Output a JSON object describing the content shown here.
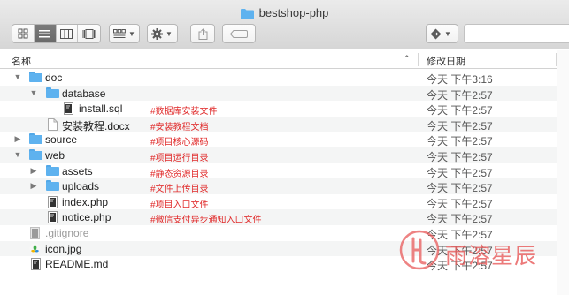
{
  "window": {
    "title": "bestshop-php"
  },
  "columns": {
    "name": "名称",
    "date": "修改日期"
  },
  "files": [
    {
      "name": "doc",
      "date": "今天 下午3:16",
      "note": ""
    },
    {
      "name": "database",
      "date": "今天 下午2:57",
      "note": ""
    },
    {
      "name": "install.sql",
      "date": "今天 下午2:57",
      "note": "#数据库安装文件"
    },
    {
      "name": "安装教程.docx",
      "date": "今天 下午2:57",
      "note": "#安装教程文档"
    },
    {
      "name": "source",
      "date": "今天 下午2:57",
      "note": "#项目核心源码"
    },
    {
      "name": "web",
      "date": "今天 下午2:57",
      "note": "#项目运行目录"
    },
    {
      "name": "assets",
      "date": "今天 下午2:57",
      "note": "#静态资源目录"
    },
    {
      "name": "uploads",
      "date": "今天 下午2:57",
      "note": "#文件上传目录"
    },
    {
      "name": "index.php",
      "date": "今天 下午2:57",
      "note": "#项目入口文件"
    },
    {
      "name": "notice.php",
      "date": "今天 下午2:57",
      "note": "#微信支付异步通知入口文件"
    },
    {
      "name": ".gitignore",
      "date": "今天 下午2:57",
      "note": ""
    },
    {
      "name": "icon.jpg",
      "date": "今天 下午2:57",
      "note": ""
    },
    {
      "name": "README.md",
      "date": "今天 下午2:57",
      "note": ""
    }
  ],
  "watermark": {
    "text": "雨溶星辰"
  },
  "colors": {
    "folder": "#5eb2ef",
    "note": "#e02a2a",
    "selected_view": "#6f6f6f"
  }
}
